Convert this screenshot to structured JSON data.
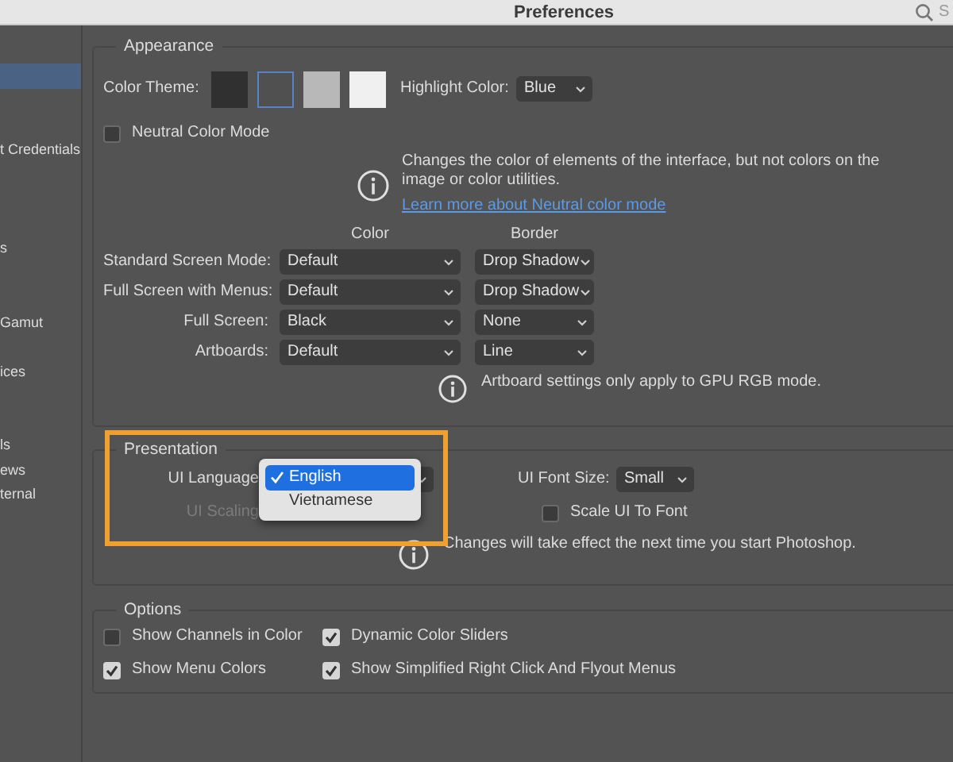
{
  "window": {
    "title": "Preferences"
  },
  "search": {
    "placeholder": "S"
  },
  "sidebar": {
    "items": [
      {
        "selected": true
      },
      {
        "label": "t Credentials",
        "selected": false
      },
      {
        "label": "s",
        "selected": false
      },
      {
        "label": "Gamut",
        "selected": false
      },
      {
        "label": "ices",
        "selected": false
      },
      {
        "label": "ls",
        "selected": false
      },
      {
        "label": "ews",
        "selected": false
      },
      {
        "label": "ternal",
        "selected": false
      }
    ]
  },
  "appearance": {
    "title": "Appearance",
    "color_theme": {
      "label": "Color Theme:",
      "swatches": [
        {
          "color": "#303030",
          "selected": false
        },
        {
          "color": "#505050",
          "selected": true
        },
        {
          "color": "#b8b8b8",
          "selected": false
        },
        {
          "color": "#f0f0f0",
          "selected": false
        }
      ]
    },
    "highlight_color": {
      "label": "Highlight Color:",
      "value": "Blue"
    },
    "neutral_color_mode": {
      "label": "Neutral Color Mode",
      "checked": false
    },
    "info": {
      "text": "Changes the color of elements of the interface, but not colors on the image or color utilities.",
      "link": "Learn more about Neutral color mode"
    },
    "columns": [
      "Color",
      "Border"
    ],
    "rows": [
      {
        "label": "Standard Screen Mode:",
        "values": [
          "Default",
          "Drop Shadow"
        ]
      },
      {
        "label": "Full Screen with Menus:",
        "values": [
          "Default",
          "Drop Shadow"
        ]
      },
      {
        "label": "Full Screen:",
        "values": [
          "Black",
          "None"
        ]
      },
      {
        "label": "Artboards:",
        "values": [
          "Default",
          "Line"
        ]
      }
    ],
    "note": "Artboard settings only apply to GPU RGB mode."
  },
  "presentation": {
    "title": "Presentation",
    "ui_language": {
      "label": "UI Language",
      "menu": [
        {
          "label": "English",
          "selected": true
        },
        {
          "label": "Vietnamese",
          "selected": false
        }
      ]
    },
    "ui_scaling": {
      "label": "UI Scaling",
      "disabled": true
    },
    "ui_font_size": {
      "label": "UI Font Size:",
      "value": "Small"
    },
    "scale_ui_to_font": {
      "label": "Scale UI To Font",
      "checked": false
    },
    "note": "Changes will take effect the next time you start Photoshop."
  },
  "options": {
    "title": "Options",
    "checkboxes": [
      {
        "label": "Show Channels in Color",
        "checked": false
      },
      {
        "label": "Dynamic Color Sliders",
        "checked": true
      },
      {
        "label": "Show Menu Colors",
        "checked": true
      },
      {
        "label": "Show Simplified Right Click And Flyout Menus",
        "checked": true
      }
    ]
  }
}
